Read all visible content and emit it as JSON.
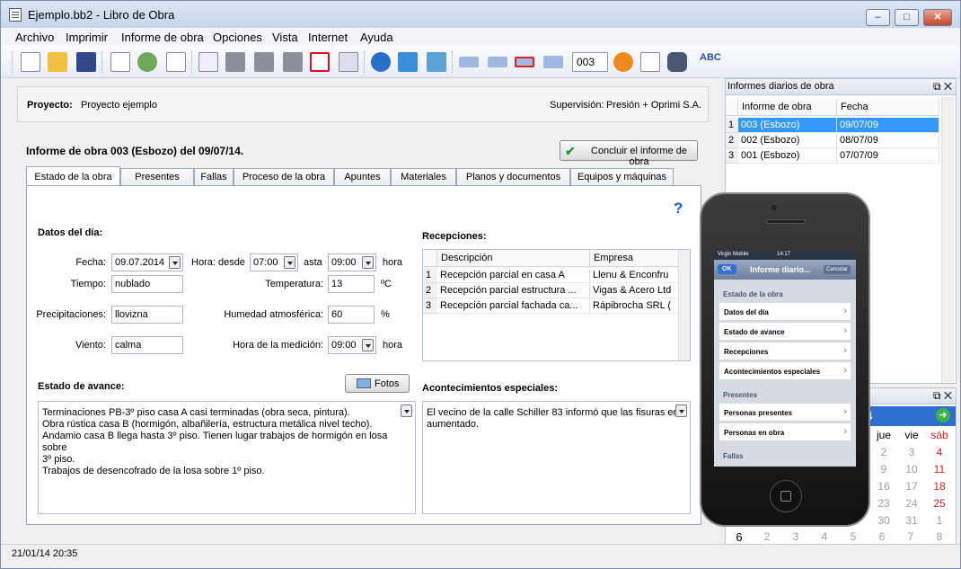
{
  "window": {
    "title": "Ejemplo.bb2 - Libro de Obra",
    "buttons": {
      "minimize": "–",
      "maximize": "□",
      "close": "✕"
    }
  },
  "menu": [
    "Archivo",
    "Imprimir",
    "Informe de obra",
    "Opciones",
    "Vista",
    "Internet",
    "Ayuda"
  ],
  "toolbar": {
    "report_number": "003",
    "icons": [
      "new-doc-icon",
      "open-folder-icon",
      "save-icon",
      "list-icon",
      "users-icon",
      "document-icon",
      "preview-icon",
      "print-icon",
      "print2-icon",
      "print3-icon",
      "pdf-icon",
      "export-icon",
      "email-icon",
      "web-icon",
      "image-icon",
      "insert-row-icon",
      "move-row-icon",
      "delete-row-icon",
      "edit-row-icon",
      "goto-icon",
      "calendar-icon",
      "find-icon",
      "spellcheck-icon"
    ]
  },
  "project": {
    "label": "Proyecto:",
    "name": "Proyecto ejemplo",
    "supervision_label": "Supervisión:",
    "supervision": "Presión + Oprimi S.A."
  },
  "report": {
    "heading": "Informe de obra 003 (Esbozo) del 09/07/14.",
    "close_button": "Concluir el informe de obra"
  },
  "tabs": [
    "Estado de la obra",
    "Presentes",
    "Fallas",
    "Proceso de la obra",
    "Apuntes",
    "Materiales",
    "Planos y documentos",
    "Equipos y máquinas"
  ],
  "day_data": {
    "section": "Datos del día:",
    "fecha_label": "Fecha:",
    "fecha": "09.07.2014",
    "hora_desde_label": "Hora: desde",
    "hora_desde": "07:00",
    "asta_label": "asta",
    "hora_asta": "09:00",
    "hora_unit": "hora",
    "tiempo_label": "Tiempo:",
    "tiempo": "nublado",
    "temperatura_label": "Temperatura:",
    "temperatura": "13",
    "temperatura_unit": "ºC",
    "precip_label": "Precipitaciones:",
    "precip": "llovizna",
    "humedad_label": "Humedad atmosférica:",
    "humedad": "60",
    "humedad_unit": "%",
    "viento_label": "Viento:",
    "viento": "calma",
    "medicion_label": "Hora de la medición:",
    "medicion": "09:00",
    "medicion_unit": "hora"
  },
  "avance": {
    "label": "Estado de avance:",
    "fotos_button": "Fotos",
    "lines": [
      "Terminaciones PB-3º piso casa A casi terminadas (obra seca, pintura).",
      "Obra rústica casa B (hormigón, albañilería, estructura metálica nivel techo).",
      "Andamio casa B llega hasta 3º piso. Tienen lugar trabajos de hormigón en losa sobre",
      "3º piso.",
      "Trabajos de desencofrado de la losa sobre 1º piso."
    ]
  },
  "recepciones": {
    "label": "Recepciones:",
    "columns": [
      "Descripción",
      "Empresa"
    ],
    "rows": [
      {
        "n": "1",
        "desc": "Recepción parcial en casa A",
        "empresa": "Llenu & Enconfru"
      },
      {
        "n": "2",
        "desc": "Recepción parcial estructura ...",
        "empresa": "Vigas & Acero Ltd"
      },
      {
        "n": "3",
        "desc": "Recepción parcial fachada ca...",
        "empresa": "Rápibrocha SRL ("
      }
    ]
  },
  "acontecimientos": {
    "label": "Acontecimientos especiales:",
    "text_1": "El vecino de la calle Schiller 83 informó que las fisuras en s",
    "text_2": "aumentado."
  },
  "informes_pane": {
    "title": "Informes diarios de obra",
    "columns": [
      "Informe de obra",
      "Fecha"
    ],
    "rows": [
      {
        "n": "1",
        "informe": "003 (Esbozo)",
        "fecha": "09/07/09"
      },
      {
        "n": "2",
        "informe": "002 (Esbozo)",
        "fecha": "08/07/09"
      },
      {
        "n": "3",
        "informe": "001 (Esbozo)",
        "fecha": "07/07/09"
      }
    ]
  },
  "calendar": {
    "month_fragment": "4",
    "weekdays": [
      "jue",
      "vie",
      "sáb"
    ],
    "rows": [
      [
        "2",
        "3",
        "4"
      ],
      [
        "9",
        "10",
        "11"
      ],
      [
        "16",
        "17",
        "18"
      ],
      [
        "23",
        "24",
        "25"
      ],
      [
        "30",
        "31",
        "1"
      ]
    ],
    "bottom_row": [
      "6",
      "2",
      "3",
      "4",
      "5",
      "6",
      "7",
      "8"
    ]
  },
  "phone": {
    "carrier": "Virgin Mobile",
    "time": "14:17",
    "ok": "OK",
    "title": "Informe diario...",
    "cancel": "Cancelar",
    "section1": "Estado de la obra",
    "items1": [
      "Datos del día",
      "Estado de avance",
      "Recepciones",
      "Acontecimientos especiales"
    ],
    "section2": "Presentes",
    "items2": [
      "Personas presentes",
      "Personas en obra"
    ],
    "section3": "Fallas"
  },
  "status": {
    "timestamp": "21/01/14 20:35"
  },
  "help": "?",
  "colors": {
    "selection": "#3399ff",
    "title_bar": "#c5d6ec",
    "red_day": "#dd2222"
  }
}
